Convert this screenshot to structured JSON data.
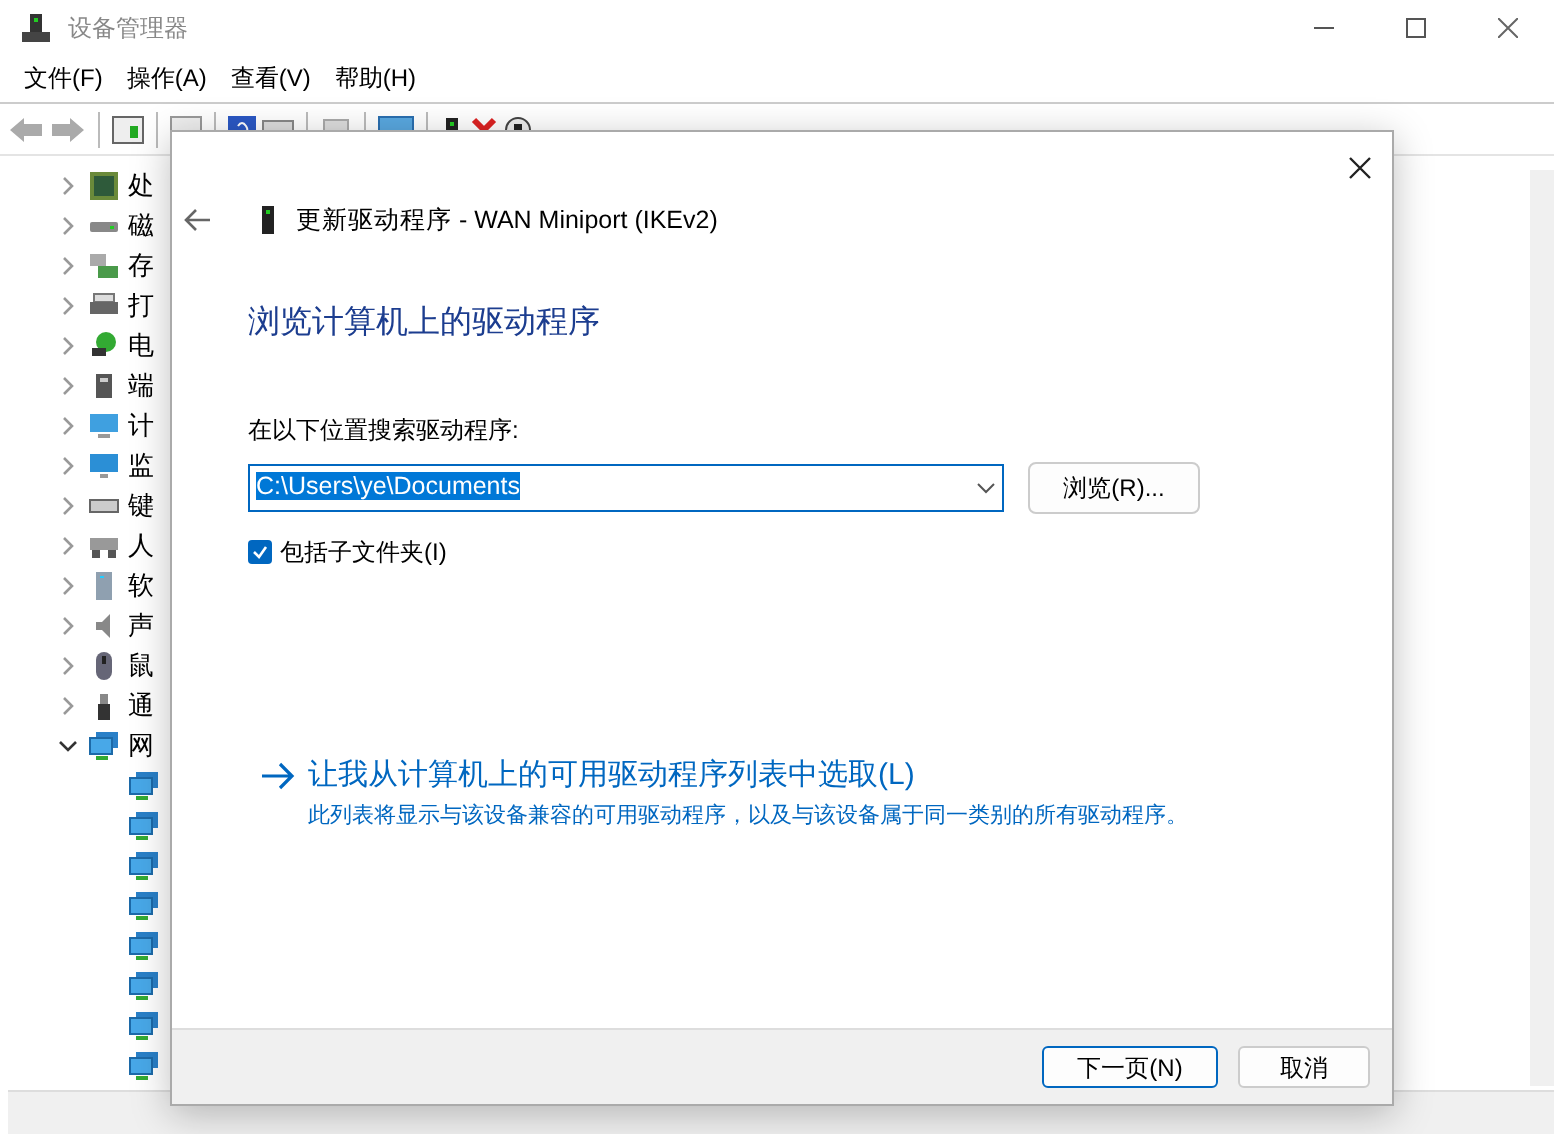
{
  "window": {
    "title": "设备管理器"
  },
  "menu": [
    "文件(F)",
    "操作(A)",
    "查看(V)",
    "帮助(H)"
  ],
  "tree": [
    {
      "label": "处",
      "kind": "processor",
      "expanded": false
    },
    {
      "label": "磁",
      "kind": "disk",
      "expanded": false
    },
    {
      "label": "存",
      "kind": "storage",
      "expanded": false
    },
    {
      "label": "打",
      "kind": "printer",
      "expanded": false
    },
    {
      "label": "电",
      "kind": "battery",
      "expanded": false
    },
    {
      "label": "端",
      "kind": "port",
      "expanded": false
    },
    {
      "label": "计",
      "kind": "computer",
      "expanded": false
    },
    {
      "label": "监",
      "kind": "monitor",
      "expanded": false
    },
    {
      "label": "键",
      "kind": "keyboard",
      "expanded": false
    },
    {
      "label": "人",
      "kind": "hid",
      "expanded": false
    },
    {
      "label": "软",
      "kind": "software",
      "expanded": false
    },
    {
      "label": "声",
      "kind": "sound",
      "expanded": false
    },
    {
      "label": "鼠",
      "kind": "mouse",
      "expanded": false
    },
    {
      "label": "通",
      "kind": "usb",
      "expanded": false
    },
    {
      "label": "网",
      "kind": "network",
      "expanded": true,
      "children": [
        {
          "kind": "network"
        },
        {
          "kind": "network"
        },
        {
          "kind": "network"
        },
        {
          "kind": "network"
        },
        {
          "kind": "network"
        },
        {
          "kind": "network"
        },
        {
          "kind": "network"
        },
        {
          "kind": "network"
        }
      ]
    }
  ],
  "dialog": {
    "title": "更新驱动程序 - WAN Miniport (IKEv2)",
    "heading": "浏览计算机上的驱动程序",
    "search_label": "在以下位置搜索驱动程序:",
    "path_value": "C:\\Users\\ye\\Documents",
    "browse_button": "浏览(R)...",
    "include_subfolders": {
      "label": "包括子文件夹(I)",
      "checked": true
    },
    "pick_link": "让我从计算机上的可用驱动程序列表中选取(L)",
    "pick_description": "此列表将显示与该设备兼容的可用驱动程序，以及与该设备属于同一类别的所有驱动程序。",
    "buttons": [
      {
        "label": "下一页(N)",
        "kind": "primary"
      },
      {
        "label": "取消",
        "kind": "secondary"
      }
    ]
  }
}
